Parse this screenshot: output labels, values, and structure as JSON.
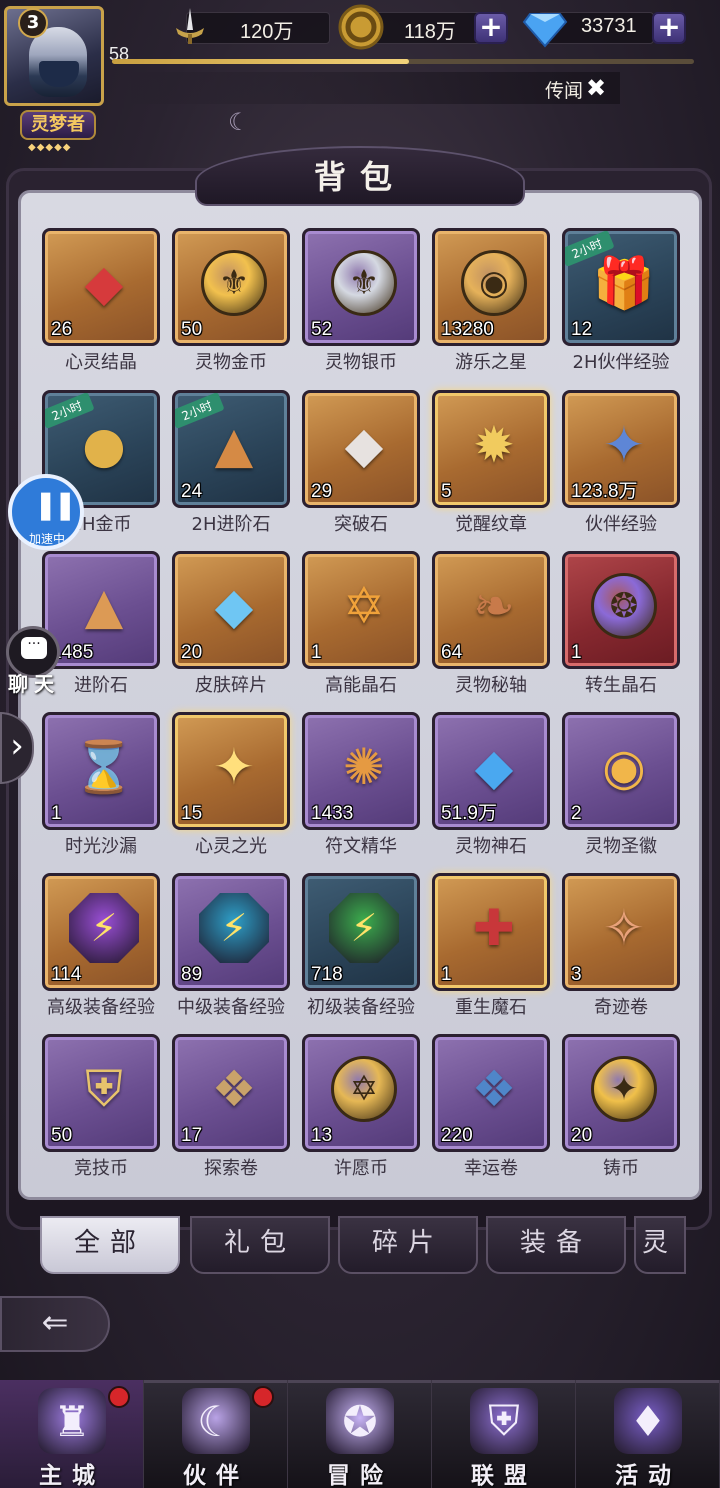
{
  "hud": {
    "player_level": "3",
    "exp_level": "58",
    "exp_progress": 0.51,
    "power_value": "120万",
    "gold_value": "118万",
    "diamond_value": "33731",
    "player_title": "灵梦者",
    "title_stars": "◆◆◆◆◆",
    "legend_label": "传闻",
    "legend_close": "✖"
  },
  "panel": {
    "title": "背包"
  },
  "items": [
    {
      "name": "心灵结晶",
      "count": "26",
      "frame": "gold",
      "icon": "red-crystal-icon",
      "glyph": "◆",
      "color": "#d63a3c"
    },
    {
      "name": "灵物金币",
      "count": "50",
      "frame": "gold",
      "icon": "gold-coin-icon",
      "glyph": "⚜",
      "color": "#f2c14e",
      "shape": "coin"
    },
    {
      "name": "灵物银币",
      "count": "52",
      "frame": "purple",
      "icon": "silver-coin-icon",
      "glyph": "⚜",
      "color": "#d5d9e2",
      "shape": "coin"
    },
    {
      "name": "游乐之星",
      "count": "13280",
      "frame": "gold",
      "icon": "star-coin-icon",
      "glyph": "◉",
      "color": "#e6b25a",
      "shape": "coin"
    },
    {
      "name": "2H伙伴经验",
      "count": "12",
      "frame": "blue",
      "icon": "gift-box-icon",
      "glyph": "🎁",
      "color": "#a78de0",
      "ribbon": "2小时"
    },
    {
      "name": "2H金币",
      "count": "",
      "frame": "blue",
      "icon": "coin-pile-icon",
      "glyph": "●",
      "color": "#e1b24a",
      "ribbon": "2小时"
    },
    {
      "name": "2H进阶石",
      "count": "24",
      "frame": "blue",
      "icon": "ore-pile-icon",
      "glyph": "▲",
      "color": "#d58a45",
      "ribbon": "2小时"
    },
    {
      "name": "突破石",
      "count": "29",
      "frame": "gold",
      "icon": "breakthrough-stone-icon",
      "glyph": "◆",
      "color": "#e7e2e0"
    },
    {
      "name": "觉醒纹章",
      "count": "5",
      "frame": "gold",
      "icon": "awakening-emblem-icon",
      "glyph": "✹",
      "color": "#f1cb5e",
      "glow": true
    },
    {
      "name": "伙伴经验",
      "count": "123.8万",
      "frame": "gold",
      "icon": "exp-star-icon",
      "glyph": "✦",
      "color": "#5e86d6"
    },
    {
      "name": "进阶石",
      "count": "1485",
      "frame": "purple",
      "icon": "advance-stone-icon",
      "glyph": "▲",
      "color": "#dc9a55"
    },
    {
      "name": "皮肤碎片",
      "count": "20",
      "frame": "gold",
      "icon": "skin-shard-icon",
      "glyph": "◆",
      "color": "#6fc6f3"
    },
    {
      "name": "高能晶石",
      "count": "1",
      "frame": "gold",
      "icon": "energy-crystal-icon",
      "glyph": "✡",
      "color": "#f0a23a"
    },
    {
      "name": "灵物秘轴",
      "count": "64",
      "frame": "gold",
      "icon": "scroll-icon",
      "glyph": "❧",
      "color": "#c87a4a"
    },
    {
      "name": "转生晶石",
      "count": "1",
      "frame": "red",
      "icon": "rebirth-orb-icon",
      "glyph": "❂",
      "color": "#8b6ad8",
      "shape": "coin"
    },
    {
      "name": "时光沙漏",
      "count": "1",
      "frame": "purple",
      "icon": "hourglass-icon",
      "glyph": "⌛",
      "color": "#d9c08a"
    },
    {
      "name": "心灵之光",
      "count": "15",
      "frame": "gold",
      "icon": "spirit-light-icon",
      "glyph": "✦",
      "color": "#ffdf7c",
      "glow": true
    },
    {
      "name": "符文精华",
      "count": "1433",
      "frame": "purple",
      "icon": "rune-essence-icon",
      "glyph": "✺",
      "color": "#e59a42"
    },
    {
      "name": "灵物神石",
      "count": "51.9万",
      "frame": "purple",
      "icon": "blue-crystal-icon",
      "glyph": "◆",
      "color": "#4aa8f0"
    },
    {
      "name": "灵物圣徽",
      "count": "2",
      "frame": "purple",
      "icon": "holy-emblem-icon",
      "glyph": "◉",
      "color": "#f1b64a"
    },
    {
      "name": "高级装备经验",
      "count": "114",
      "frame": "gold",
      "icon": "purple-bolt-icon",
      "glyph": "⚡",
      "color": "#9a4fd6",
      "shape": "hex"
    },
    {
      "name": "中级装备经验",
      "count": "89",
      "frame": "purple",
      "icon": "blue-bolt-icon",
      "glyph": "⚡",
      "color": "#2ea0c9",
      "shape": "hex"
    },
    {
      "name": "初级装备经验",
      "count": "718",
      "frame": "blue",
      "icon": "green-bolt-icon",
      "glyph": "⚡",
      "color": "#3cae4e",
      "shape": "hex"
    },
    {
      "name": "重生魔石",
      "count": "1",
      "frame": "gold",
      "icon": "rebirth-stone-icon",
      "glyph": "✚",
      "color": "#c8373a",
      "glow": true
    },
    {
      "name": "奇迹卷",
      "count": "3",
      "frame": "gold",
      "icon": "miracle-scroll-icon",
      "glyph": "✧",
      "color": "#e9a27a"
    },
    {
      "name": "竞技币",
      "count": "50",
      "frame": "purple",
      "icon": "arena-coin-icon",
      "glyph": "⛨",
      "color": "#e7c36c"
    },
    {
      "name": "探索卷",
      "count": "17",
      "frame": "purple",
      "icon": "map-scroll-icon",
      "glyph": "❖",
      "color": "#c9a26a"
    },
    {
      "name": "许愿币",
      "count": "13",
      "frame": "purple",
      "icon": "wish-coin-icon",
      "glyph": "✡",
      "color": "#e6b855",
      "shape": "coin"
    },
    {
      "name": "幸运卷",
      "count": "220",
      "frame": "purple",
      "icon": "luck-scroll-icon",
      "glyph": "❖",
      "color": "#4f86c9"
    },
    {
      "name": "铸币",
      "count": "20",
      "frame": "purple",
      "icon": "mint-coin-icon",
      "glyph": "✦",
      "color": "#f0c04a",
      "shape": "coin"
    }
  ],
  "tabs": [
    {
      "label": "全部",
      "active": true
    },
    {
      "label": "礼包",
      "active": false
    },
    {
      "label": "碎片",
      "active": false
    },
    {
      "label": "装备",
      "active": false
    },
    {
      "label": "灵",
      "active": false
    }
  ],
  "side": {
    "speed_label": "加速中",
    "chat_label": "聊天",
    "chat_icon": "···",
    "expand_icon": "›",
    "back_icon": "⇐"
  },
  "nav": [
    {
      "label": "主城",
      "icon": "castle-icon",
      "glyph": "♜",
      "color": "#9d7ce0",
      "active": true,
      "dot": true
    },
    {
      "label": "伙伴",
      "icon": "partner-icon",
      "glyph": "☾",
      "color": "#b9a3e6",
      "active": false,
      "dot": true
    },
    {
      "label": "冒险",
      "icon": "adventure-icon",
      "glyph": "✪",
      "color": "#c7b3f5",
      "active": false,
      "dot": false
    },
    {
      "label": "联盟",
      "icon": "alliance-icon",
      "glyph": "⛨",
      "color": "#8c6fd0",
      "active": false,
      "dot": false
    },
    {
      "label": "活动",
      "icon": "activity-icon",
      "glyph": "♦",
      "color": "#7a5fc8",
      "active": false,
      "dot": false
    }
  ]
}
